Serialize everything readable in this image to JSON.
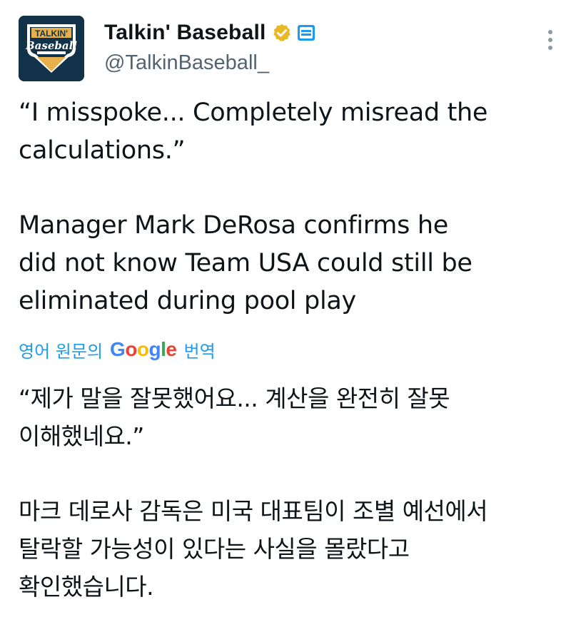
{
  "account": {
    "display_name": "Talkin' Baseball",
    "handle": "@TalkinBaseball_",
    "avatar_text": {
      "line1": "TALKIN'",
      "line2": "Baseball"
    },
    "verified_icon": "gold-verified-badge-icon",
    "affiliate_icon": "affiliate-badge-icon",
    "verified_color": "#e8b828"
  },
  "tweet": {
    "paragraphs": [
      "“I misspoke... Completely misread the\ncalculations.”",
      "Manager Mark DeRosa confirms he\ndid not know Team USA could still be\neliminated during pool play"
    ]
  },
  "translation": {
    "label": "영어 원문의",
    "provider": "Google",
    "suffix": "번역",
    "paragraphs": [
      "“제가 말을 잘못했어요... 계산을 완전히 잘못\n이해했네요.”",
      "마크 데로사 감독은 미국 대표팀이 조별 예선에서\n탈락할 가능성이 있다는 사실을 몰랐다고\n확인했습니다."
    ]
  },
  "menu": {
    "icon": "more-vertical-icon"
  },
  "colors": {
    "text": "#0f1419",
    "secondary": "#536471",
    "link": "#1d9bf0"
  }
}
